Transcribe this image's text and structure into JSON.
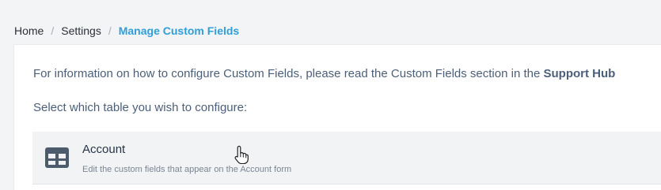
{
  "breadcrumb": {
    "home": "Home",
    "settings": "Settings",
    "separator": "/",
    "current": "Manage Custom Fields"
  },
  "main": {
    "intro_text": "For information on how to configure Custom Fields, please read the Custom Fields section in the ",
    "support_hub_link": "Support Hub",
    "select_label": "Select which table you wish to configure:",
    "tables": [
      {
        "title": "Account",
        "description": "Edit the custom fields that appear on the Account form",
        "icon": "table-icon"
      }
    ]
  },
  "colors": {
    "accent": "#2f9fd8",
    "text": "#4b5f78",
    "item_background": "#f2f3f5"
  }
}
